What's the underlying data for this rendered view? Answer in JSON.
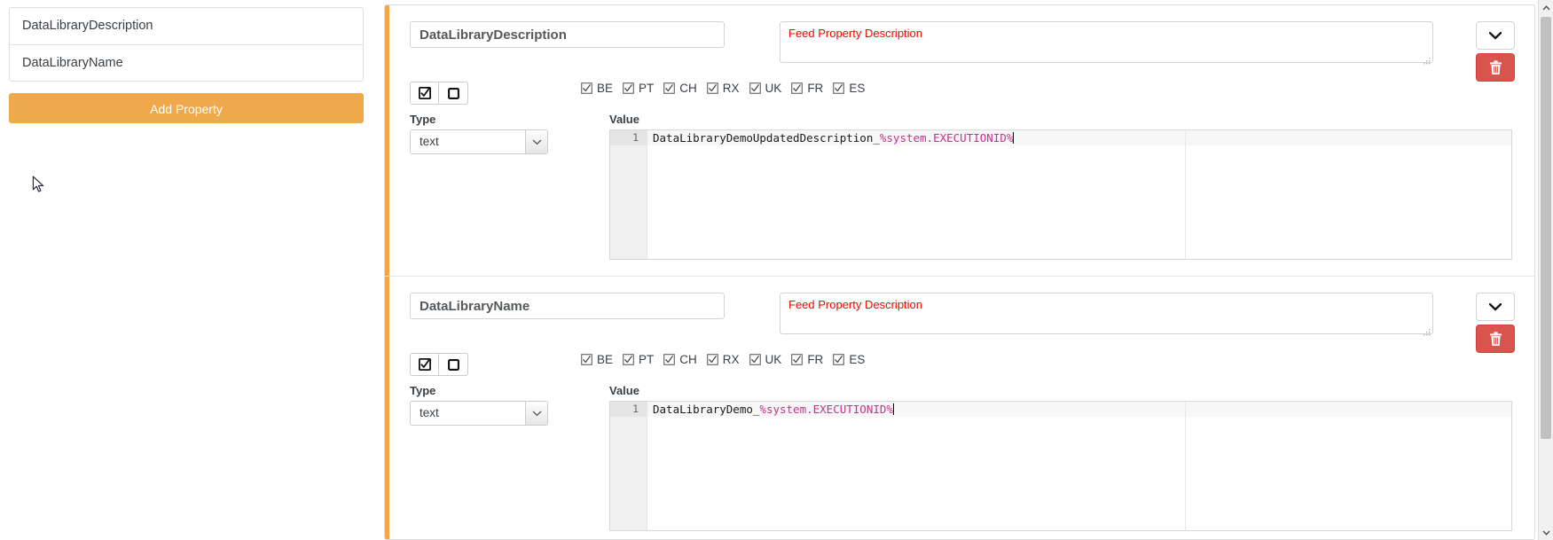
{
  "sidebar": {
    "property_list": [
      {
        "label": "DataLibraryDescription"
      },
      {
        "label": "DataLibraryName"
      }
    ],
    "add_property_label": "Add Property"
  },
  "colors": {
    "accent_orange": "#efa94a",
    "danger_red": "#d9534f",
    "placeholder_red": "#ff0000",
    "code_variable_magenta": "#c4338b"
  },
  "sections": [
    {
      "name_value": "DataLibraryDescription",
      "description_placeholder": "Feed Property Description",
      "description_value": "",
      "toggle_checked_icon": "checkbox-checked-icon",
      "toggle_empty_icon": "checkbox-empty-icon",
      "markets": [
        {
          "code": "BE",
          "checked": true
        },
        {
          "code": "PT",
          "checked": true
        },
        {
          "code": "CH",
          "checked": true
        },
        {
          "code": "RX",
          "checked": true
        },
        {
          "code": "UK",
          "checked": true
        },
        {
          "code": "FR",
          "checked": true
        },
        {
          "code": "ES",
          "checked": true
        }
      ],
      "type_label": "Type",
      "type_value": "text",
      "value_label": "Value",
      "code_line_number": "1",
      "code_text_plain": "DataLibraryDemoUpdatedDescription_",
      "code_text_variable": "%system.EXECUTIONID%",
      "chevron_icon": "chevron-down-icon",
      "delete_icon": "trash-icon"
    },
    {
      "name_value": "DataLibraryName",
      "description_placeholder": "Feed Property Description",
      "description_value": "",
      "toggle_checked_icon": "checkbox-checked-icon",
      "toggle_empty_icon": "checkbox-empty-icon",
      "markets": [
        {
          "code": "BE",
          "checked": true
        },
        {
          "code": "PT",
          "checked": true
        },
        {
          "code": "CH",
          "checked": true
        },
        {
          "code": "RX",
          "checked": true
        },
        {
          "code": "UK",
          "checked": true
        },
        {
          "code": "FR",
          "checked": true
        },
        {
          "code": "ES",
          "checked": true
        }
      ],
      "type_label": "Type",
      "type_value": "text",
      "value_label": "Value",
      "code_line_number": "1",
      "code_text_plain": "DataLibraryDemo_",
      "code_text_variable": "%system.EXECUTIONID%",
      "chevron_icon": "chevron-down-icon",
      "delete_icon": "trash-icon"
    }
  ],
  "scrollbar": {
    "up_icon": "chevron-up-icon",
    "down_icon": "chevron-down-icon"
  }
}
